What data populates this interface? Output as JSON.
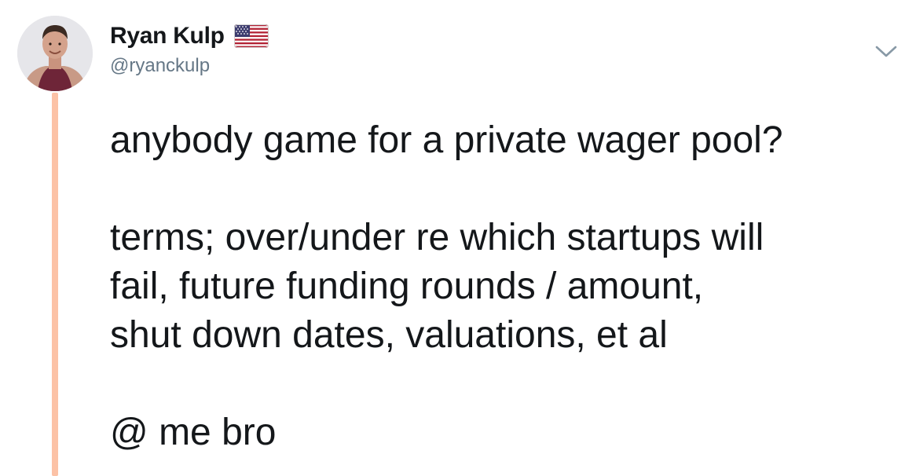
{
  "tweet": {
    "author": {
      "display_name": "Ryan Kulp",
      "handle": "@ryanckulp",
      "flag_icon": "us-flag-emoji-icon",
      "avatar_icon": "profile-photo"
    },
    "menu_icon": "chevron-down-icon",
    "text": {
      "line1": "anybody game for a private wager pool?",
      "line2": "terms; over/under re which startups will",
      "line3": "fail, future funding rounds / amount,",
      "line4": "shut down dates, valuations, et al",
      "line5": "@ me bro"
    },
    "colors": {
      "thread_line": "#fcc2a6",
      "handle": "#657786",
      "text": "#14171a"
    }
  }
}
